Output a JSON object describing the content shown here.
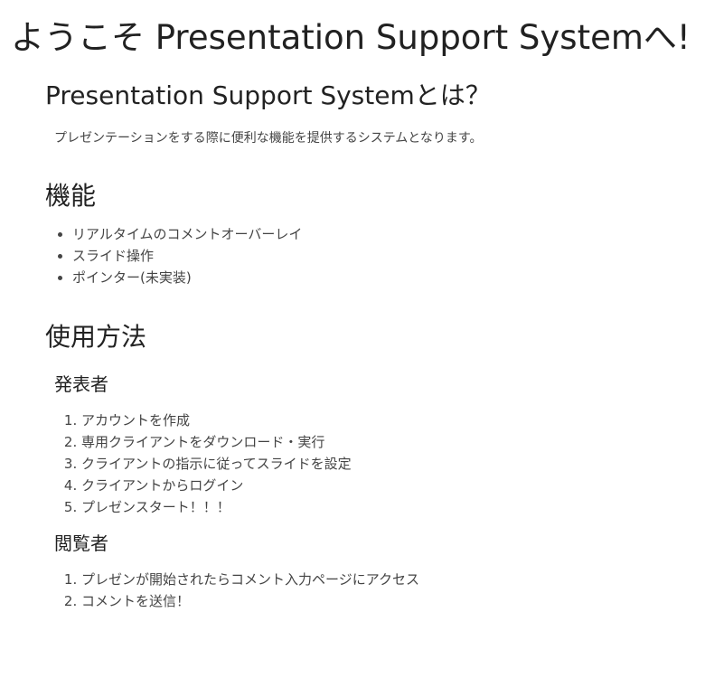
{
  "page_title": "ようこそ Presentation Support Systemへ!",
  "about": {
    "heading": "Presentation Support Systemとは？",
    "description": "プレゼンテーションをする際に便利な機能を提供するシステムとなります。"
  },
  "features": {
    "heading": "機能",
    "items": [
      "リアルタイムのコメントオーバーレイ",
      "スライド操作",
      "ポインター(未実装)"
    ]
  },
  "usage": {
    "heading": "使用方法",
    "presenter": {
      "heading": "発表者",
      "steps": [
        "アカウントを作成",
        "専用クライアントをダウンロード・実行",
        "クライアントの指示に従ってスライドを設定",
        "クライアントからログイン",
        "プレゼンスタート！！！"
      ]
    },
    "viewer": {
      "heading": "閲覧者",
      "steps": [
        "プレゼンが開始されたらコメント入力ページにアクセス",
        "コメントを送信！"
      ]
    }
  }
}
